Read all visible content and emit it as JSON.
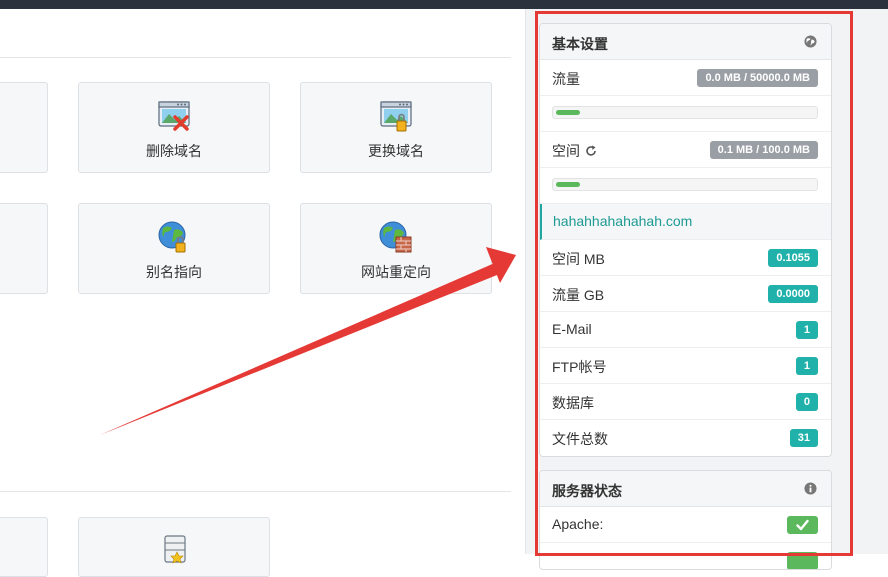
{
  "tiles": [
    {
      "label": "删除域名",
      "icon": "delete-domain-icon"
    },
    {
      "label": "更换域名",
      "icon": "change-domain-icon"
    },
    {
      "label": "别名指向",
      "icon": "alias-globe-icon"
    },
    {
      "label": "网站重定向",
      "icon": "redirect-globe-icon"
    }
  ],
  "sidebar": {
    "basic": {
      "title": "基本设置",
      "head_icon": "globe-icon",
      "traffic_label": "流量",
      "traffic_value": "0.0 MB / 50000.0 MB",
      "traffic_fraction": 0.0,
      "space_label": "空间",
      "space_value": "0.1 MB / 100.0 MB",
      "space_fraction": 0.001,
      "refresh_icon": "refresh-icon",
      "domain": "hahahhahahahah.com",
      "stats": [
        {
          "label": "空间 MB",
          "value": "0.1055"
        },
        {
          "label": "流量 GB",
          "value": "0.0000"
        },
        {
          "label": "E-Mail",
          "value": "1"
        },
        {
          "label": "FTP帐号",
          "value": "1"
        },
        {
          "label": "数据库",
          "value": "0"
        },
        {
          "label": "文件总数",
          "value": "31"
        }
      ]
    },
    "server": {
      "title": "服务器状态",
      "head_icon": "info-icon",
      "apache_label": "Apache:",
      "apache_status_icon": "check-icon"
    }
  },
  "colors": {
    "accent": "#20b2aa",
    "success": "#5cb85c",
    "annotation": "#e53935",
    "topbar": "#2b323d"
  }
}
